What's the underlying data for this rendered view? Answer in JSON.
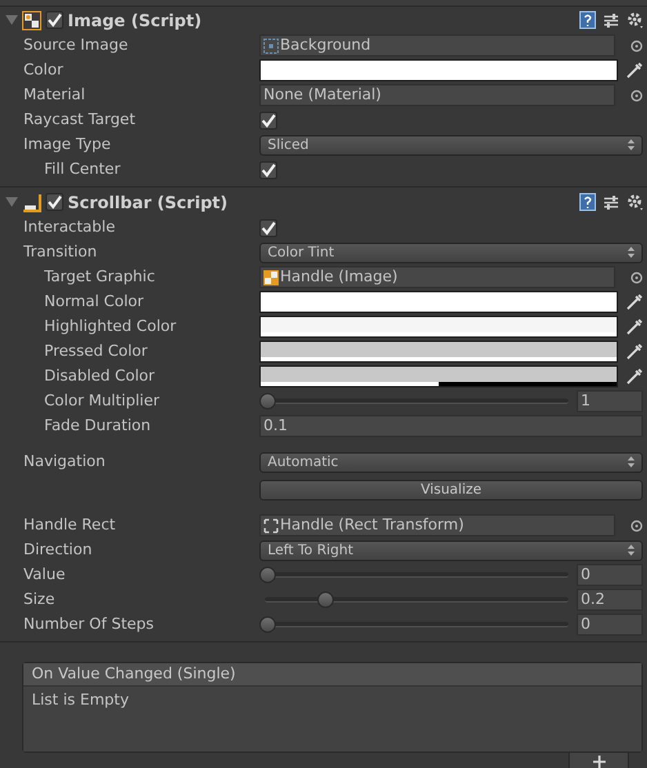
{
  "components": [
    {
      "title": "Image (Script)",
      "expanded": true,
      "enabled": true,
      "properties": [
        {
          "label": "Source Image",
          "kind": "object",
          "value": "Background"
        },
        {
          "label": "Color",
          "kind": "color",
          "color": "#ffffff",
          "level": 1
        },
        {
          "label": "Material",
          "kind": "object",
          "value": "None (Material)"
        },
        {
          "label": "Raycast Target",
          "kind": "checkbox",
          "checked": true
        },
        {
          "label": "Image Type",
          "kind": "dropdown",
          "value": "Sliced"
        },
        {
          "label": "Fill Center",
          "kind": "checkbox",
          "checked": true,
          "indented": true
        }
      ]
    },
    {
      "title": "Scrollbar (Script)",
      "expanded": true,
      "enabled": true,
      "properties": [
        {
          "label": "Interactable",
          "kind": "checkbox",
          "checked": true
        },
        {
          "label": "Transition",
          "kind": "dropdown",
          "value": "Color Tint"
        },
        {
          "label": "Target Graphic",
          "kind": "object",
          "value": "Handle (Image)",
          "indented": true
        },
        {
          "label": "Normal Color",
          "kind": "color",
          "color": "#ffffff",
          "level": 1,
          "indented": true
        },
        {
          "label": "Highlighted Color",
          "kind": "color",
          "color": "#f5f5f5",
          "level": 1,
          "indented": true
        },
        {
          "label": "Pressed Color",
          "kind": "color",
          "color": "#c8c8c8",
          "level": 1,
          "indented": true
        },
        {
          "label": "Disabled Color",
          "kind": "color",
          "color": "#c8c8c8",
          "level": 0.5,
          "indented": true
        },
        {
          "label": "Color Multiplier",
          "kind": "slider",
          "level": 0,
          "reading": "1",
          "indented": true
        },
        {
          "label": "Fade Duration",
          "kind": "number",
          "value": "0.1",
          "indented": true
        },
        {
          "label": "Navigation",
          "kind": "dropdown",
          "value": "Automatic",
          "gap_before": true
        },
        {
          "kind": "button",
          "value": "Visualize"
        },
        {
          "label": "Handle Rect",
          "kind": "object",
          "value": "Handle (Rect Transform)"
        },
        {
          "label": "Direction",
          "kind": "dropdown",
          "value": "Left To Right"
        },
        {
          "label": "Value",
          "kind": "slider",
          "level": 0,
          "reading": "0"
        },
        {
          "label": "Size",
          "kind": "slider",
          "level": 0.2,
          "reading": "0.2"
        },
        {
          "label": "Number Of Steps",
          "kind": "slider",
          "level": 0,
          "reading": "0"
        }
      ]
    }
  ],
  "event": {
    "title": "On Value Changed (Single)",
    "body": "List is Empty"
  }
}
